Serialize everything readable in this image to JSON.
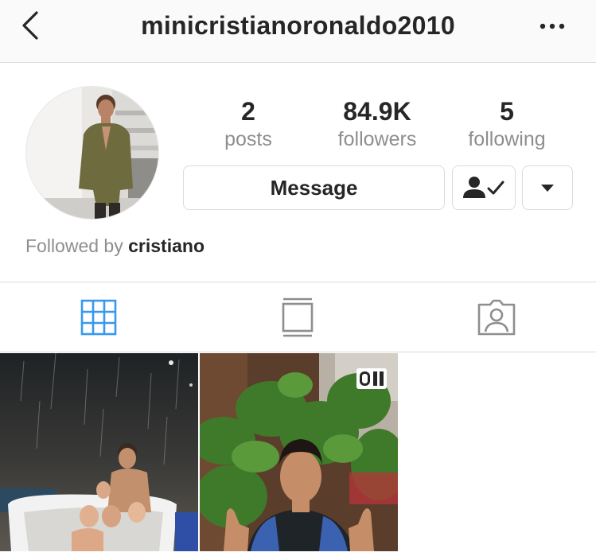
{
  "header": {
    "username": "minicristianoronaldo2010",
    "back_icon": "chevron-left-icon",
    "more_icon": "more-horizontal-icon"
  },
  "profile": {
    "stats": [
      {
        "value": "2",
        "label": "posts"
      },
      {
        "value": "84.9K",
        "label": "followers"
      },
      {
        "value": "5",
        "label": "following"
      }
    ],
    "message_label": "Message",
    "following_icon": "person-check-icon",
    "dropdown_icon": "caret-down-icon",
    "followed_by_prefix": "Followed by",
    "followed_by_user": "cristiano"
  },
  "tabs": [
    {
      "name": "grid",
      "icon": "grid-icon",
      "active": true
    },
    {
      "name": "feed",
      "icon": "feed-icon",
      "active": false
    },
    {
      "name": "tagged",
      "icon": "tagged-person-icon",
      "active": false
    }
  ],
  "posts": [
    {
      "type": "photo"
    },
    {
      "type": "video",
      "badge_icon": "igtv-icon"
    }
  ],
  "colors": {
    "accent": "#3897f0",
    "text": "#262626",
    "secondary_text": "#8e8e8e",
    "border": "#dbdbdb",
    "header_bg": "#fafafa"
  }
}
